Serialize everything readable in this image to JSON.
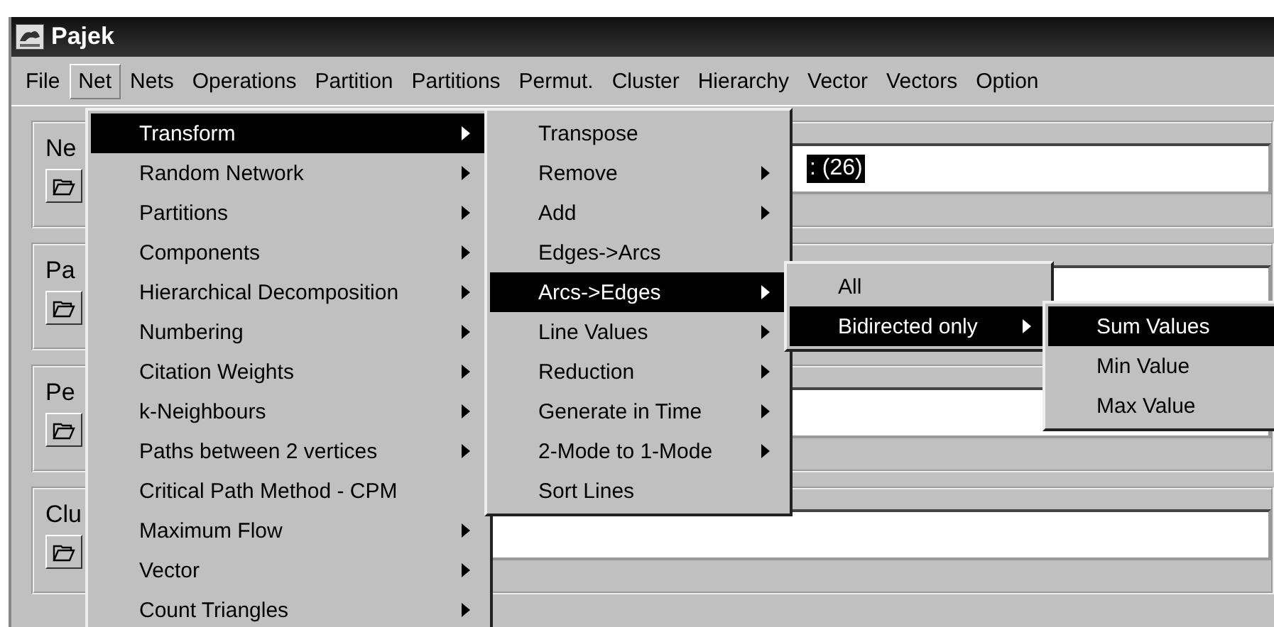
{
  "window": {
    "title": "Pajek"
  },
  "menubar": [
    {
      "label": "File",
      "selected": false
    },
    {
      "label": "Net",
      "selected": true
    },
    {
      "label": "Nets",
      "selected": false
    },
    {
      "label": "Operations",
      "selected": false
    },
    {
      "label": "Partition",
      "selected": false
    },
    {
      "label": "Partitions",
      "selected": false
    },
    {
      "label": "Permut.",
      "selected": false
    },
    {
      "label": "Cluster",
      "selected": false
    },
    {
      "label": "Hierarchy",
      "selected": false
    },
    {
      "label": "Vector",
      "selected": false
    },
    {
      "label": "Vectors",
      "selected": false
    },
    {
      "label": "Option",
      "selected": false
    }
  ],
  "panels": [
    {
      "label": "Ne",
      "value": ": (26)"
    },
    {
      "label": "Pa"
    },
    {
      "label": "Pe"
    },
    {
      "label": "Clu"
    }
  ],
  "menus": [
    {
      "items": [
        {
          "label": "Transform",
          "submenu": true,
          "selected": true
        },
        {
          "label": "Random Network",
          "submenu": true,
          "selected": false
        },
        {
          "label": "Partitions",
          "submenu": true,
          "selected": false
        },
        {
          "label": "Components",
          "submenu": true,
          "selected": false
        },
        {
          "label": "Hierarchical Decomposition",
          "submenu": true,
          "selected": false
        },
        {
          "label": "Numbering",
          "submenu": true,
          "selected": false
        },
        {
          "label": "Citation Weights",
          "submenu": true,
          "selected": false
        },
        {
          "label": "k-Neighbours",
          "submenu": true,
          "selected": false
        },
        {
          "label": "Paths between 2 vertices",
          "submenu": true,
          "selected": false
        },
        {
          "label": "Critical Path Method - CPM",
          "submenu": false,
          "selected": false
        },
        {
          "label": "Maximum Flow",
          "submenu": true,
          "selected": false
        },
        {
          "label": "Vector",
          "submenu": true,
          "selected": false
        },
        {
          "label": "Count Triangles",
          "submenu": true,
          "selected": false
        }
      ]
    },
    {
      "items": [
        {
          "label": "Transpose",
          "submenu": false,
          "selected": false
        },
        {
          "label": "Remove",
          "submenu": true,
          "selected": false
        },
        {
          "label": "Add",
          "submenu": true,
          "selected": false
        },
        {
          "label": "Edges->Arcs",
          "submenu": false,
          "selected": false
        },
        {
          "label": "Arcs->Edges",
          "submenu": true,
          "selected": true
        },
        {
          "label": "Line Values",
          "submenu": true,
          "selected": false
        },
        {
          "label": "Reduction",
          "submenu": true,
          "selected": false
        },
        {
          "label": "Generate in Time",
          "submenu": true,
          "selected": false
        },
        {
          "label": "2-Mode to 1-Mode",
          "submenu": true,
          "selected": false
        },
        {
          "label": "Sort Lines",
          "submenu": false,
          "selected": false
        }
      ]
    },
    {
      "items": [
        {
          "label": "All",
          "submenu": false,
          "selected": false
        },
        {
          "label": "Bidirected only",
          "submenu": true,
          "selected": true
        }
      ]
    },
    {
      "items": [
        {
          "label": "Sum Values",
          "submenu": false,
          "selected": true
        },
        {
          "label": "Min Value",
          "submenu": false,
          "selected": false
        },
        {
          "label": "Max Value",
          "submenu": false,
          "selected": false
        }
      ]
    }
  ]
}
